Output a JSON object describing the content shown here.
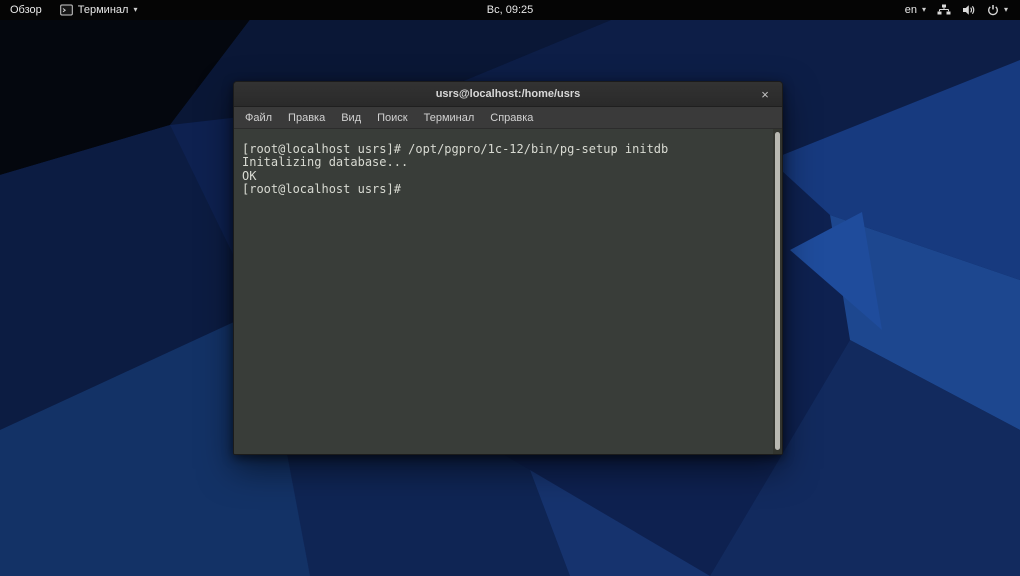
{
  "topbar": {
    "activities_label": "Обзор",
    "app_menu_label": "Терминал",
    "clock": "Вс, 09:25",
    "keyboard_layout": "en",
    "chevron": "▾"
  },
  "window": {
    "title": "usrs@localhost:/home/usrs",
    "close_label": "×",
    "menu": [
      "Файл",
      "Правка",
      "Вид",
      "Поиск",
      "Терминал",
      "Справка"
    ],
    "lines": [
      "[root@localhost usrs]# /opt/pgpro/1c-12/bin/pg-setup initdb",
      "Initalizing database...",
      "OK",
      "[root@localhost usrs]# "
    ]
  },
  "icons": {
    "app": "terminal-icon",
    "network": "network-icon",
    "volume": "volume-icon",
    "power": "power-icon"
  },
  "colors": {
    "topbar_bg": "#050505",
    "titlebar_bg": "#2d2d2d",
    "menubar_bg": "#3a3a3a",
    "terminal_bg": "#393d39",
    "terminal_fg": "#d8dad2",
    "wallpaper_base": "#0d204e",
    "scroll_thumb": "#b9b9b2"
  }
}
